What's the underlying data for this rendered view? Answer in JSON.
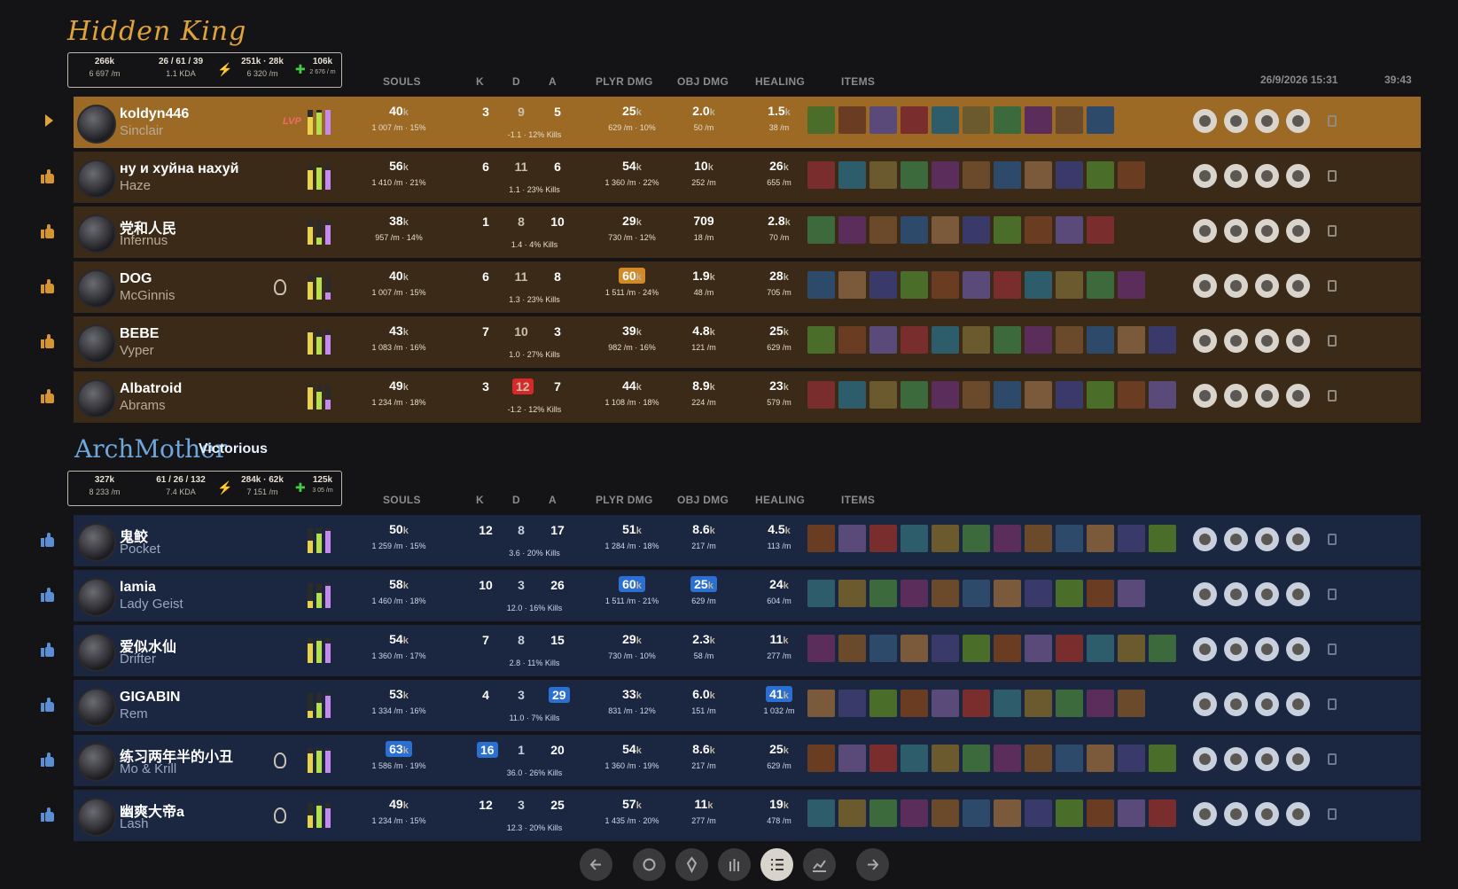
{
  "match": {
    "date": "26/9/2026 15:31",
    "duration": "39:43"
  },
  "headers": {
    "souls": "SOULS",
    "k": "K",
    "d": "D",
    "a": "A",
    "plyr_dmg": "PLYR DMG",
    "obj_dmg": "OBJ DMG",
    "healing": "HEALING",
    "items": "ITEMS"
  },
  "teams": [
    {
      "name": "Hidden King",
      "result": "",
      "summary": {
        "souls": "266k",
        "souls_rate": "6 697 /m",
        "kda": "26 / 61 / 39",
        "kda_ratio": "1.1 KDA",
        "damage": "251k · 28k",
        "damage_rate": "6 320 /m",
        "healing": "106k",
        "healing_rate": "2 676 / m"
      },
      "players": [
        {
          "name": "koldyn446",
          "hero": "Sinclair",
          "badge": "LVP",
          "souls": "40",
          "souls_sub": "1 007 /m · 15%",
          "k": "3",
          "d": "9",
          "a": "5",
          "kda_sub": "-1.1 · 12% Kills",
          "plyr": "25",
          "plyr_sub": "629 /m · 10%",
          "obj": "2.0",
          "obj_sub": "50 /m",
          "heal": "1.5",
          "heal_sub": "38 /m"
        },
        {
          "name": "ну и хуйна нахуй",
          "hero": "Haze",
          "badge": "",
          "souls": "56",
          "souls_sub": "1 410 /m · 21%",
          "k": "6",
          "d": "11",
          "a": "6",
          "kda_sub": "1.1 · 23% Kills",
          "plyr": "54",
          "plyr_sub": "1 360 /m · 22%",
          "obj": "10",
          "obj_sub": "252 /m",
          "heal": "26",
          "heal_sub": "655 /m"
        },
        {
          "name": "党和人民",
          "hero": "Infernus",
          "badge": "",
          "souls": "38",
          "souls_sub": "957 /m · 14%",
          "k": "1",
          "d": "8",
          "a": "10",
          "kda_sub": "1.4 · 4% Kills",
          "plyr": "29",
          "plyr_sub": "730 /m · 12%",
          "obj": "709",
          "obj_sub": "18 /m",
          "heal": "2.8",
          "heal_sub": "70 /m"
        },
        {
          "name": "DOG",
          "hero": "McGinnis",
          "badge": "",
          "souls": "40",
          "souls_sub": "1 007 /m · 15%",
          "k": "6",
          "d": "11",
          "a": "8",
          "kda_sub": "1.3 · 23% Kills",
          "plyr": "60",
          "plyr_sub": "1 511 /m · 24%",
          "obj": "1.9",
          "obj_sub": "48 /m",
          "heal": "28",
          "heal_sub": "705 /m"
        },
        {
          "name": "BEBE",
          "hero": "Vyper",
          "badge": "",
          "souls": "43",
          "souls_sub": "1 083 /m · 16%",
          "k": "7",
          "d": "10",
          "a": "3",
          "kda_sub": "1.0 · 27% Kills",
          "plyr": "39",
          "plyr_sub": "982 /m · 16%",
          "obj": "4.8",
          "obj_sub": "121 /m",
          "heal": "25",
          "heal_sub": "629 /m"
        },
        {
          "name": "Albatroid",
          "hero": "Abrams",
          "badge": "",
          "souls": "49",
          "souls_sub": "1 234 /m · 18%",
          "k": "3",
          "d": "12",
          "a": "7",
          "kda_sub": "-1.2 · 12% Kills",
          "plyr": "44",
          "plyr_sub": "1 108 /m · 18%",
          "obj": "8.9",
          "obj_sub": "224 /m",
          "heal": "23",
          "heal_sub": "579 /m"
        }
      ]
    },
    {
      "name": "ArchMother",
      "result": "Victorious",
      "summary": {
        "souls": "327k",
        "souls_rate": "8 233 /m",
        "kda": "61 / 26 / 132",
        "kda_ratio": "7.4 KDA",
        "damage": "284k · 62k",
        "damage_rate": "7 151 /m",
        "healing": "125k",
        "healing_rate": "3 05 /m"
      },
      "players": [
        {
          "name": "鬼鲛",
          "hero": "Pocket",
          "badge": "",
          "souls": "50",
          "souls_sub": "1 259 /m · 15%",
          "k": "12",
          "d": "8",
          "a": "17",
          "kda_sub": "3.6 · 20% Kills",
          "plyr": "51",
          "plyr_sub": "1 284 /m · 18%",
          "obj": "8.6",
          "obj_sub": "217 /m",
          "heal": "4.5",
          "heal_sub": "113 /m"
        },
        {
          "name": "lamia",
          "hero": "Lady Geist",
          "badge": "",
          "souls": "58",
          "souls_sub": "1 460 /m · 18%",
          "k": "10",
          "d": "3",
          "a": "26",
          "kda_sub": "12.0 · 16% Kills",
          "plyr": "60",
          "plyr_sub": "1 511 /m · 21%",
          "obj": "25",
          "obj_sub": "629 /m",
          "heal": "24",
          "heal_sub": "604 /m"
        },
        {
          "name": "爱似水仙",
          "hero": "Drifter",
          "badge": "",
          "souls": "54",
          "souls_sub": "1 360 /m · 17%",
          "k": "7",
          "d": "8",
          "a": "15",
          "kda_sub": "2.8 · 11% Kills",
          "plyr": "29",
          "plyr_sub": "730 /m · 10%",
          "obj": "2.3",
          "obj_sub": "58 /m",
          "heal": "11",
          "heal_sub": "277 /m"
        },
        {
          "name": "GIGABIN",
          "hero": "Rem",
          "badge": "",
          "souls": "53",
          "souls_sub": "1 334 /m · 16%",
          "k": "4",
          "d": "3",
          "a": "29",
          "kda_sub": "11.0 · 7% Kills",
          "plyr": "33",
          "plyr_sub": "831 /m · 12%",
          "obj": "6.0",
          "obj_sub": "151 /m",
          "heal": "41",
          "heal_sub": "1 032 /m"
        },
        {
          "name": "练习两年半的小丑",
          "hero": "Mo & Krill",
          "badge": "",
          "souls": "63",
          "souls_sub": "1 586 /m · 19%",
          "k": "16",
          "d": "1",
          "a": "20",
          "kda_sub": "36.0 · 26% Kills",
          "plyr": "54",
          "plyr_sub": "1 360 /m · 19%",
          "obj": "8.6",
          "obj_sub": "217 /m",
          "heal": "25",
          "heal_sub": "629 /m"
        },
        {
          "name": "幽爽大帝a",
          "hero": "Lash",
          "badge": "",
          "souls": "49",
          "souls_sub": "1 234 /m · 15%",
          "k": "12",
          "d": "3",
          "a": "25",
          "kda_sub": "12.3 · 20% Kills",
          "plyr": "57",
          "plyr_sub": "1 435 /m · 20%",
          "obj": "11",
          "obj_sub": "277 /m",
          "heal": "19",
          "heal_sub": "478 /m"
        }
      ]
    }
  ],
  "k_suffix": "k",
  "nav": [
    "back-icon",
    "souls-icon",
    "rank-icon",
    "hand-icon",
    "scoreboard-icon",
    "graph-icon",
    "forward-icon"
  ]
}
